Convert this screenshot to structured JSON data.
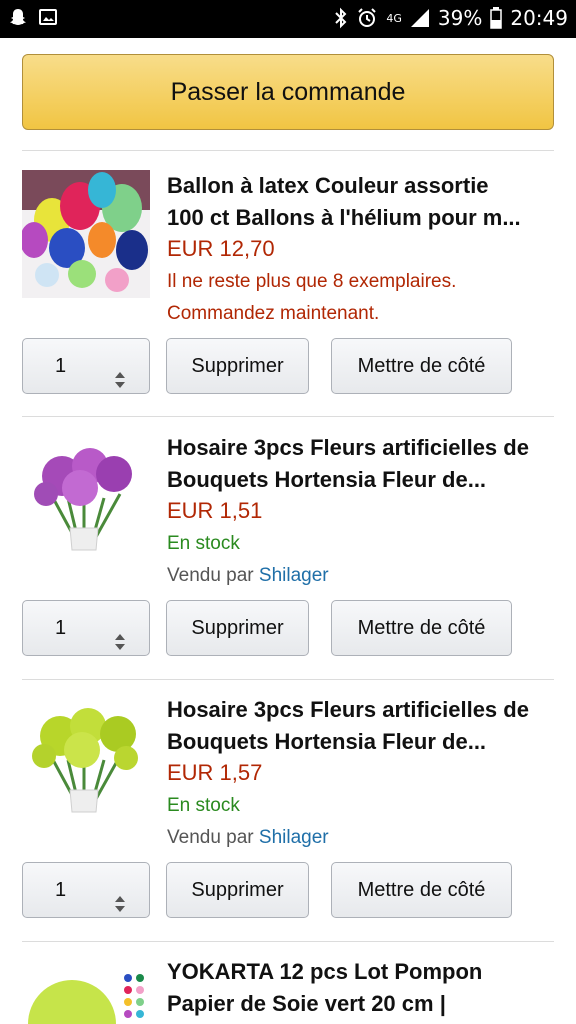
{
  "status_bar": {
    "network": "4G",
    "battery": "39%",
    "time": "20:49",
    "icons": [
      "snapchat-icon",
      "gallery-icon",
      "bluetooth-icon",
      "alarm-icon",
      "signal-icon",
      "battery-icon"
    ]
  },
  "checkout": {
    "label": "Passer la commande"
  },
  "items": [
    {
      "title_line1": "Ballon à latex Couleur assortie",
      "title_line2": "100 ct Ballons à l'hélium pour m...",
      "price": "EUR 12,70",
      "warning_line1": "Il ne reste plus que 8 exemplaires.",
      "warning_line2": "Commandez maintenant.",
      "quantity": "1",
      "delete_label": "Supprimer",
      "save_label": "Mettre de côté"
    },
    {
      "title_line1": "Hosaire 3pcs Fleurs artificielles de",
      "title_line2": "Bouquets Hortensia Fleur de...",
      "price": "EUR 1,51",
      "stock": "En stock",
      "sold_by": "Vendu par",
      "seller": "Shilager",
      "quantity": "1",
      "delete_label": "Supprimer",
      "save_label": "Mettre de côté"
    },
    {
      "title_line1": "Hosaire 3pcs Fleurs artificielles de",
      "title_line2": "Bouquets Hortensia Fleur de...",
      "price": "EUR 1,57",
      "stock": "En stock",
      "sold_by": "Vendu par",
      "seller": "Shilager",
      "quantity": "1",
      "delete_label": "Supprimer",
      "save_label": "Mettre de côté"
    },
    {
      "title_line1": "YOKARTA 12 pcs Lot Pompon",
      "title_line2": "Papier de Soie vert 20 cm |"
    }
  ],
  "colors": {
    "price": "#b12704",
    "in_stock": "#2a8a1f",
    "seller_link": "#1f6fa8",
    "checkout_button": "#f1c543"
  }
}
